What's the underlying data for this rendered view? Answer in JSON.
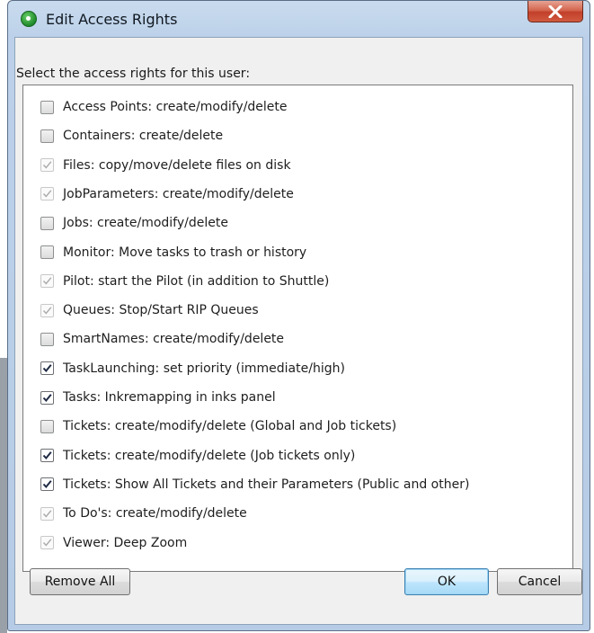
{
  "window": {
    "title": "Edit Access Rights",
    "close_label": "X"
  },
  "prompt": "Select the access rights for this user:",
  "permissions": [
    {
      "label": "Access Points: create/modify/delete",
      "state": "unchecked"
    },
    {
      "label": "Containers: create/delete",
      "state": "unchecked"
    },
    {
      "label": "Files: copy/move/delete files on disk",
      "state": "checked-disabled"
    },
    {
      "label": "JobParameters: create/modify/delete",
      "state": "checked-disabled"
    },
    {
      "label": "Jobs: create/modify/delete",
      "state": "unchecked"
    },
    {
      "label": "Monitor: Move tasks to trash or history",
      "state": "unchecked"
    },
    {
      "label": "Pilot: start the Pilot (in addition to Shuttle)",
      "state": "checked-disabled"
    },
    {
      "label": "Queues: Stop/Start RIP Queues",
      "state": "checked-disabled"
    },
    {
      "label": "SmartNames: create/modify/delete",
      "state": "unchecked"
    },
    {
      "label": "TaskLaunching: set priority (immediate/high)",
      "state": "checked"
    },
    {
      "label": "Tasks: Inkremapping in inks panel",
      "state": "checked"
    },
    {
      "label": "Tickets: create/modify/delete (Global and Job tickets)",
      "state": "unchecked"
    },
    {
      "label": "Tickets: create/modify/delete (Job tickets only)",
      "state": "checked"
    },
    {
      "label": "Tickets: Show All Tickets and their Parameters (Public and other)",
      "state": "checked"
    },
    {
      "label": "To Do's: create/modify/delete",
      "state": "checked-disabled"
    },
    {
      "label": "Viewer: Deep Zoom",
      "state": "checked-disabled"
    }
  ],
  "buttons": {
    "remove_all": "Remove All",
    "ok": "OK",
    "cancel": "Cancel"
  },
  "colors": {
    "check_active": "#1f2a44",
    "check_dim": "#a9a9a9",
    "titlebar": "#bcd1e9",
    "close_button": "#c8492f"
  }
}
